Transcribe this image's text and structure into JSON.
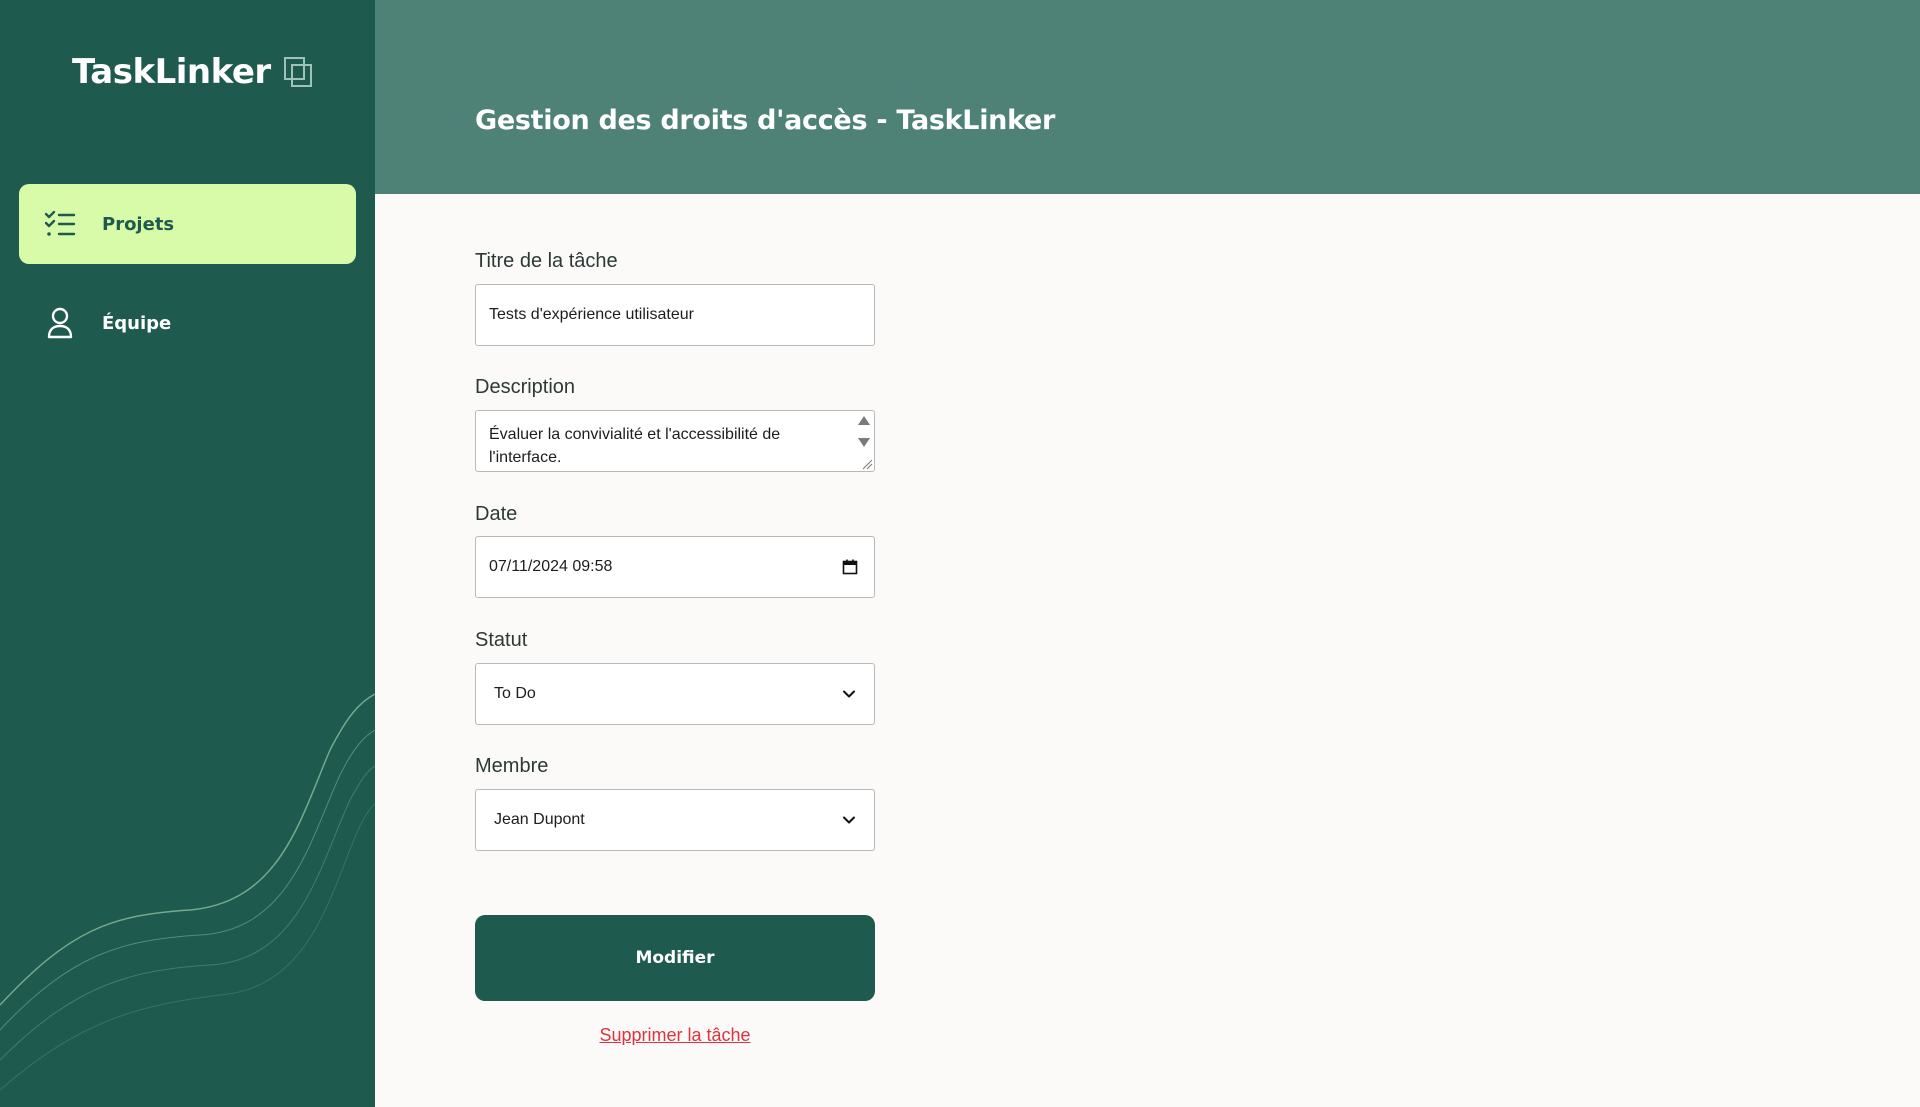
{
  "app": {
    "logo_text": "TaskLinker"
  },
  "sidebar": {
    "items": [
      {
        "label": "Projets",
        "icon": "task-list-icon",
        "active": true
      },
      {
        "label": "Équipe",
        "icon": "user-icon",
        "active": false
      }
    ]
  },
  "header": {
    "title": "Gestion des droits d'accès - TaskLinker"
  },
  "form": {
    "title_label": "Titre de la tâche",
    "title_value": "Tests d'expérience utilisateur",
    "description_label": "Description",
    "description_value": "Évaluer la convivialité et l'accessibilité de l'interface.",
    "date_label": "Date",
    "date_value": "07/11/2024 09:58",
    "status_label": "Statut",
    "status_value": "To Do",
    "member_label": "Membre",
    "member_value": "Jean Dupont",
    "submit_label": "Modifier",
    "delete_label": "Supprimer la tâche"
  },
  "colors": {
    "sidebar_bg": "#1f5a4e",
    "header_bg": "#4f8277",
    "active_nav_bg": "#d8fbaa",
    "primary_button": "#1f5a4e",
    "danger_link": "#e0333f",
    "page_bg": "#fbfaf8"
  }
}
